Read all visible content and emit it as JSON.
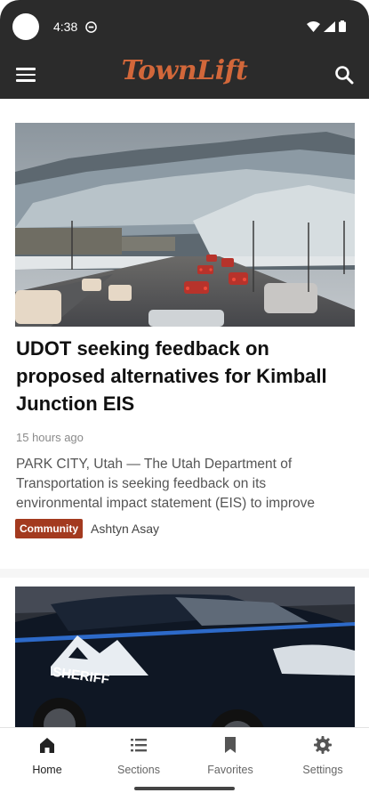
{
  "status_bar": {
    "time": "4:38"
  },
  "app_bar": {
    "logo_text": "TownLift",
    "logo_color": "#d2673a",
    "menu_icon": "menu-icon",
    "search_icon": "search-icon"
  },
  "articles": [
    {
      "headline": "UDOT seeking feedback on proposed alternatives for Kimball Junction EIS",
      "timestamp": "15 hours ago",
      "excerpt": "PARK CITY, Utah — The Utah Department of Transportation is seeking feedback on its environmental impact statement (EIS) to improve",
      "category": "Community",
      "category_color": "#a33a1f",
      "author": "Ashtyn Asay"
    },
    {
      "image_text": "SHERIFF"
    }
  ],
  "bottom_nav": {
    "items": [
      {
        "label": "Home",
        "icon": "home-icon",
        "active": true
      },
      {
        "label": "Sections",
        "icon": "list-icon",
        "active": false
      },
      {
        "label": "Favorites",
        "icon": "bookmark-icon",
        "active": false
      },
      {
        "label": "Settings",
        "icon": "gear-icon",
        "active": false
      }
    ]
  }
}
